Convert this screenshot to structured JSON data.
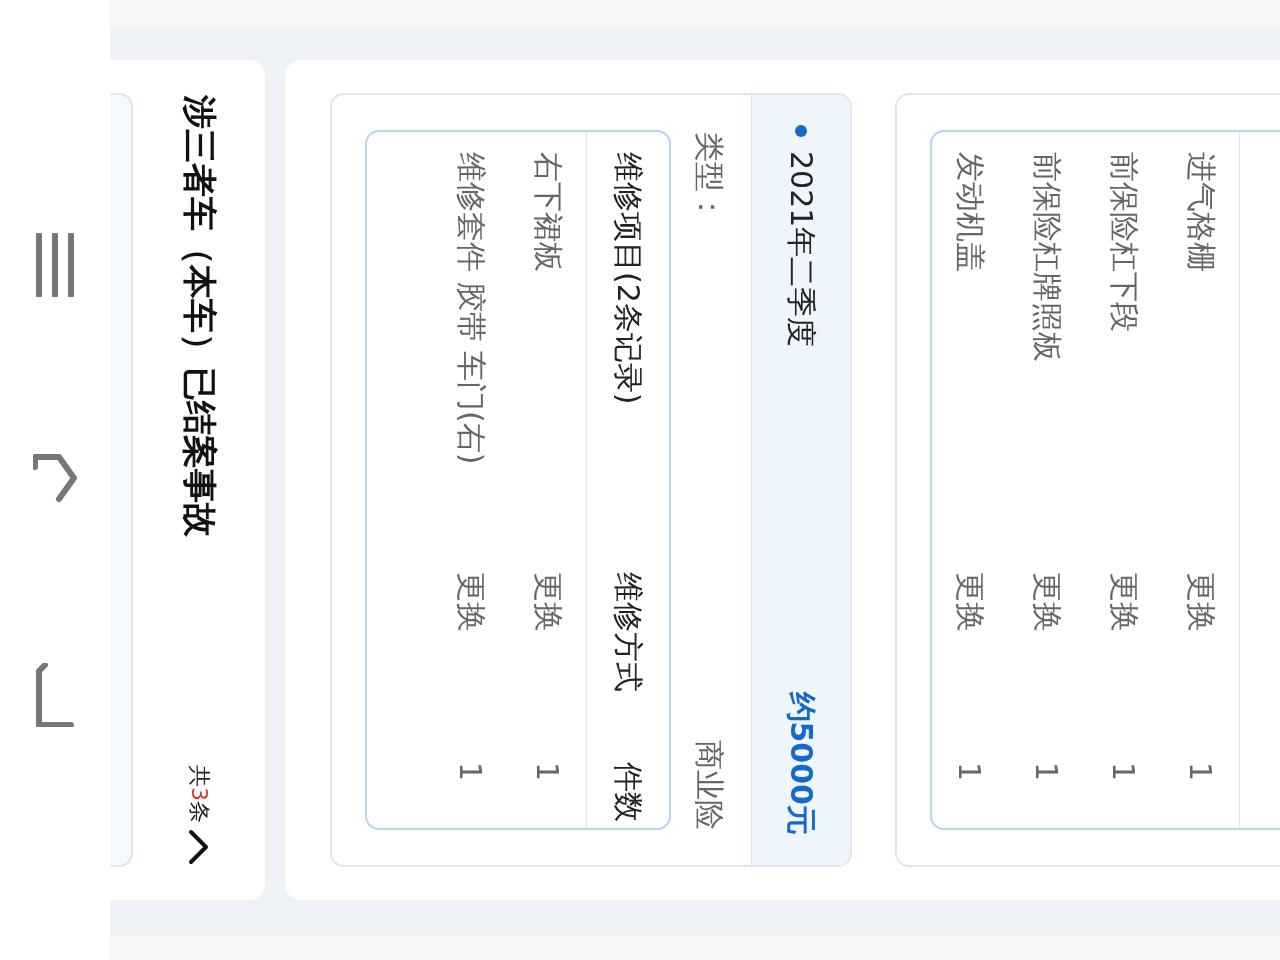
{
  "cards": [
    {
      "rows": [
        {
          "item": "进气格栅",
          "method": "更换",
          "count": "1"
        },
        {
          "item": "前保险杠下段",
          "method": "更换",
          "count": "1"
        },
        {
          "item": "前保险杠牌照板",
          "method": "更换",
          "count": "1"
        },
        {
          "item": "发动机盖",
          "method": "更换",
          "count": "1"
        }
      ]
    },
    {
      "period": "2021年二季度",
      "amount": "约5000元",
      "type_label": "类型：",
      "type_value": "商业险",
      "columns": [
        "维修项目(2条记录)",
        "维修方式",
        "件数"
      ],
      "rows": [
        {
          "item": "右下裙板",
          "method": "更换",
          "count": "1"
        },
        {
          "item": "维修套件 胶带 车门(右)",
          "method": "更换",
          "count": "1"
        }
      ]
    }
  ],
  "section": {
    "title": "涉三者车（本车）已结案事故",
    "total": {
      "before": "共",
      "number": "3",
      "after": "条"
    },
    "expanded": true
  }
}
